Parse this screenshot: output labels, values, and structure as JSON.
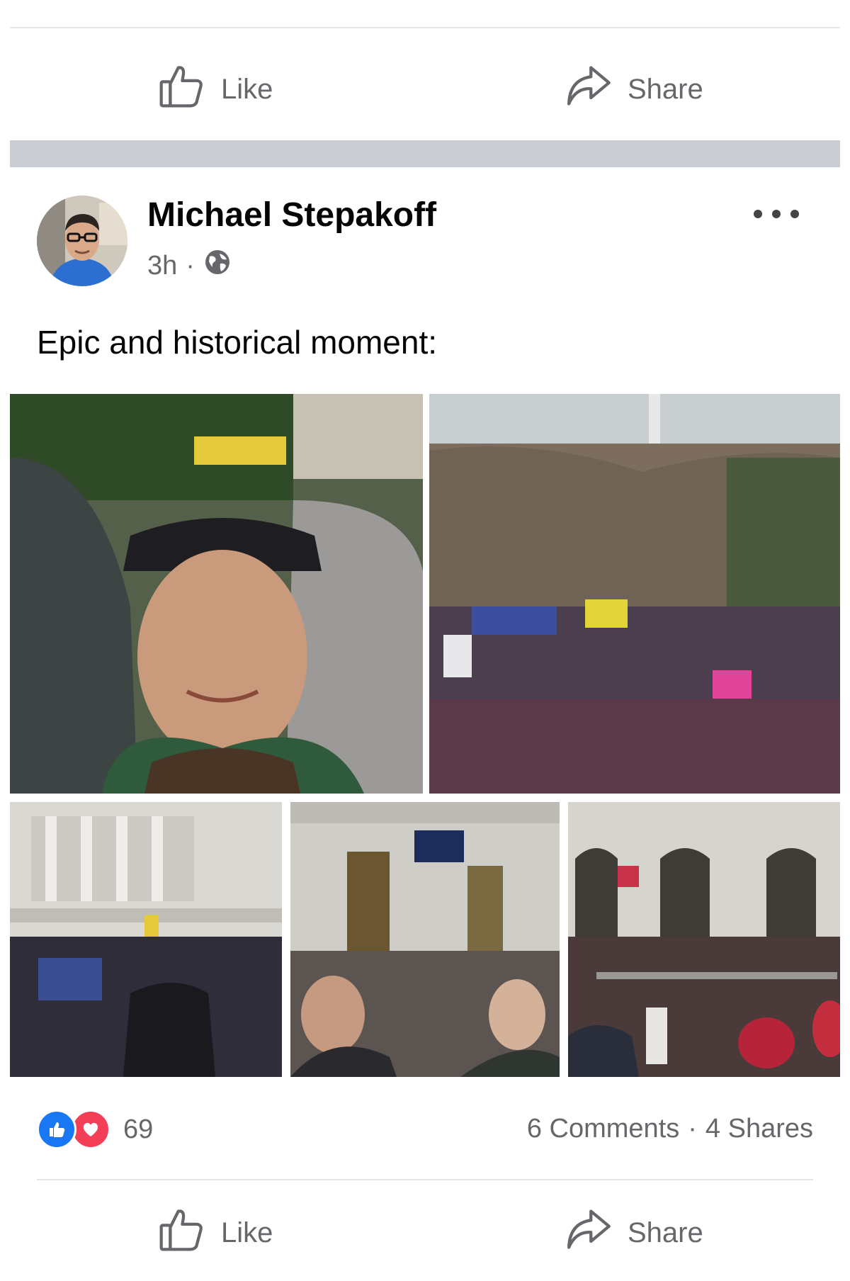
{
  "top_actions": {
    "like_label": "Like",
    "share_label": "Share"
  },
  "post": {
    "author": "Michael Stepakoff",
    "time": "3h",
    "separator": "·",
    "audience_icon": "globe-icon",
    "text": "Epic and historical moment:",
    "more_icon": "more-dots-icon",
    "photos": [
      {
        "name": "selfie-in-crowd-photo"
      },
      {
        "name": "crowd-with-flags-photo"
      },
      {
        "name": "building-columns-crowd-photo"
      },
      {
        "name": "doorway-with-flag-photo"
      },
      {
        "name": "archway-crowd-photo"
      }
    ]
  },
  "engagement": {
    "reaction_icons": [
      "like-reaction-icon",
      "love-reaction-icon"
    ],
    "reaction_count": "69",
    "comments": "6 Comments",
    "dot": "·",
    "shares": "4 Shares"
  },
  "bottom_actions": {
    "like_label": "Like",
    "share_label": "Share"
  },
  "colors": {
    "reaction_like": "#1877f2",
    "reaction_love": "#f33e58",
    "muted_text": "#65676b",
    "divider": "#c9ccd1"
  }
}
